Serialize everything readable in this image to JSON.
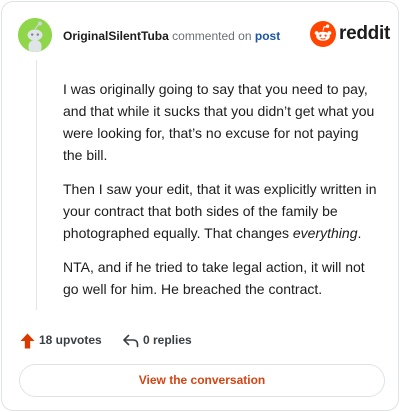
{
  "header": {
    "username": "OriginalSilentTuba",
    "action_text": "commented on",
    "post_link": "post",
    "brand": "reddit"
  },
  "comment": {
    "paragraph1": "I was originally going to say that you need to pay, and that while it sucks that you didn’t get what you were looking for, that’s no excuse for not paying the bill.",
    "paragraph2_main": "Then I saw your edit, that it was explicitly written in your contract that both sides of the family be photographed equally. That changes ",
    "paragraph2_emph": "everything",
    "paragraph2_end": ".",
    "paragraph3": "NTA, and if he tried to take legal action, it will not go well for him. He breached the contract."
  },
  "actions": {
    "upvotes": "18 upvotes",
    "replies": "0 replies"
  },
  "cta": {
    "label": "View the conversation"
  },
  "colors": {
    "accent": "#d93a00",
    "link": "#1a55a5",
    "avatar_bg": "#8fd64a"
  },
  "icons": {
    "avatar": "snoo-avatar",
    "brand": "reddit-logo-icon",
    "upvote": "upvote-arrow-icon",
    "reply": "reply-arrow-icon"
  }
}
